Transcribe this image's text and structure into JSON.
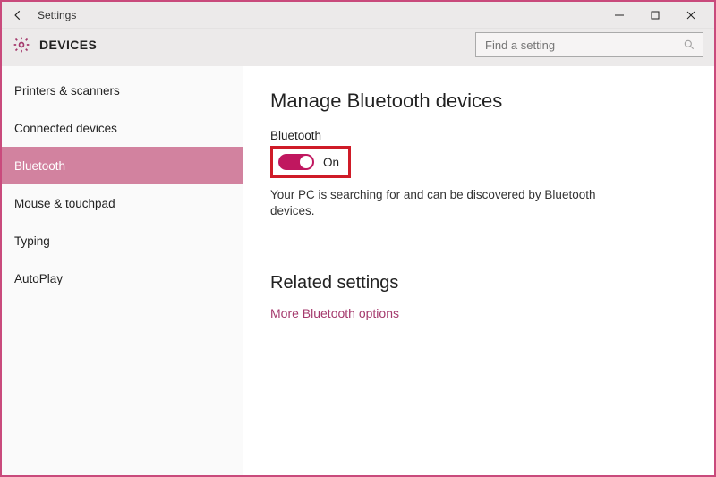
{
  "window": {
    "app_title": "Settings",
    "section_title": "DEVICES"
  },
  "search": {
    "placeholder": "Find a setting"
  },
  "sidebar": {
    "items": [
      {
        "label": "Printers & scanners",
        "active": false
      },
      {
        "label": "Connected devices",
        "active": false
      },
      {
        "label": "Bluetooth",
        "active": true
      },
      {
        "label": "Mouse & touchpad",
        "active": false
      },
      {
        "label": "Typing",
        "active": false
      },
      {
        "label": "AutoPlay",
        "active": false
      }
    ]
  },
  "main": {
    "heading": "Manage Bluetooth devices",
    "toggle_label": "Bluetooth",
    "toggle_state": "On",
    "status_text": "Your PC is searching for and can be discovered by Bluetooth devices.",
    "related_heading": "Related settings",
    "related_link": "More Bluetooth options"
  },
  "colors": {
    "accent": "#c0175f",
    "highlight_border": "#cf1b28"
  }
}
